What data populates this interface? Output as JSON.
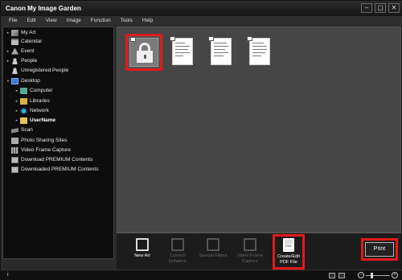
{
  "window": {
    "title": "Canon My Image Garden",
    "buttons": [
      "–",
      "▢",
      "✕"
    ]
  },
  "menubar": [
    "File",
    "Edit",
    "View",
    "Image",
    "Function",
    "Tools",
    "Help"
  ],
  "sidebar": {
    "items": [
      {
        "label": "My Art",
        "icon": "my-art-icon",
        "expander": "▸"
      },
      {
        "label": "Calendar",
        "icon": "calendar-icon",
        "expander": ""
      },
      {
        "label": "Event",
        "icon": "event-icon",
        "expander": "▸"
      },
      {
        "label": "People",
        "icon": "people-icon",
        "expander": "▸"
      },
      {
        "label": "Unregistered People",
        "icon": "unregistered-people-icon",
        "expander": ""
      },
      {
        "label": "Desktop",
        "icon": "desktop-icon",
        "expander": "▾"
      },
      {
        "label": "Computer",
        "icon": "computer-icon",
        "expander": "▸"
      },
      {
        "label": "Libraries",
        "icon": "libraries-icon",
        "expander": "▸"
      },
      {
        "label": "Network",
        "icon": "network-icon",
        "expander": "▸"
      },
      {
        "label": "UserName",
        "icon": "user-folder-icon",
        "expander": "▸"
      },
      {
        "label": "Scan",
        "icon": "scan-icon",
        "expander": ""
      },
      {
        "label": "Photo Sharing Sites",
        "icon": "photo-sharing-icon",
        "expander": ""
      },
      {
        "label": "Video Frame Capture",
        "icon": "video-capture-icon",
        "expander": ""
      },
      {
        "label": "Download PREMIUM Contents",
        "icon": "download-icon",
        "expander": ""
      },
      {
        "label": "Downloaded PREMIUM Contents",
        "icon": "downloaded-icon",
        "expander": ""
      }
    ]
  },
  "toolbar": {
    "new_art": "New Art",
    "correct_enhance": "Correct/ Enhance",
    "special_filters": "Special Filters",
    "video_frame_capture": "Video Frame Capture",
    "create_edit_pdf": "Create/Edit PDF File",
    "print": "Print"
  },
  "statusbar": {
    "info": "i",
    "zoom_minus": "−",
    "zoom_plus": "+"
  },
  "colors": {
    "highlight": "#e21a1a",
    "sidebar_bg": "#0d0d0d",
    "content_bg": "#464646"
  }
}
